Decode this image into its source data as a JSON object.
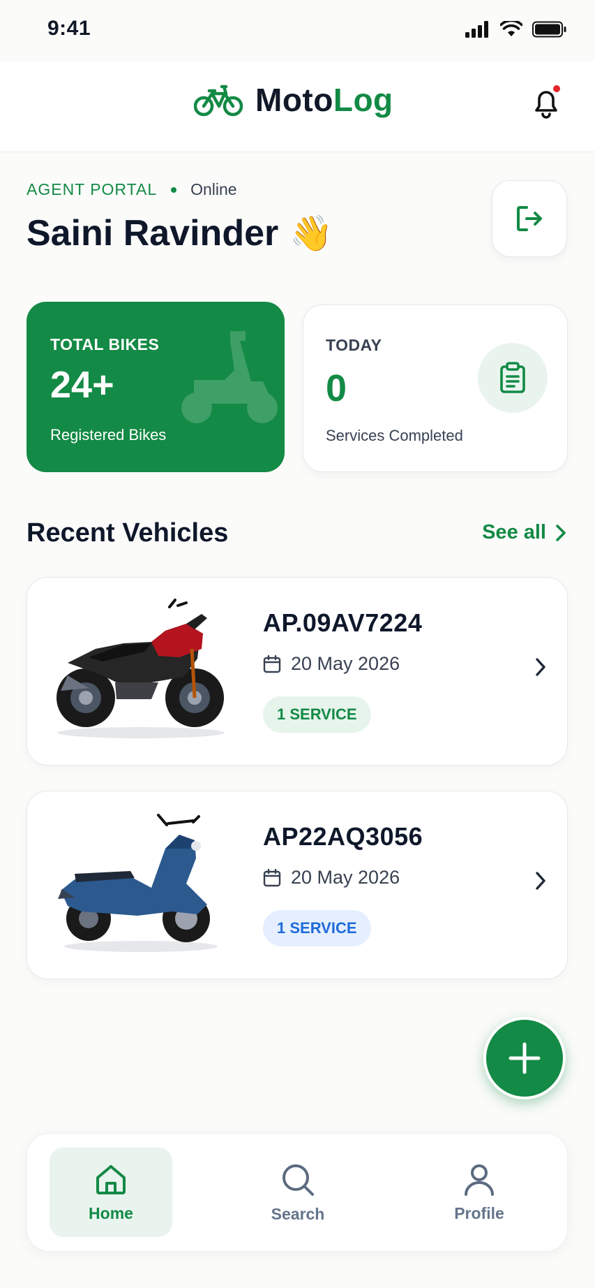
{
  "status_bar": {
    "time": "9:41"
  },
  "header": {
    "brand_part1": "Moto",
    "brand_part2": "Log",
    "notification_icon": "bell-icon",
    "has_unread": true
  },
  "greeting": {
    "portal_label": "AGENT PORTAL",
    "status": "Online",
    "name": "Saini Ravinder",
    "emoji": "👋"
  },
  "stats": {
    "total": {
      "label": "TOTAL BIKES",
      "value": "24+",
      "subtitle": "Registered Bikes"
    },
    "today": {
      "label": "TODAY",
      "value": "0",
      "subtitle": "Services Completed"
    }
  },
  "recent": {
    "title": "Recent Vehicles",
    "see_all": "See all",
    "vehicles": [
      {
        "plate": "AP.09AV7224",
        "date": "20 May 2026",
        "badge": "1 SERVICE",
        "badge_color": "#138a45",
        "type": "motorcycle"
      },
      {
        "plate": "AP22AQ3056",
        "date": "20 May 2026",
        "badge": "1 SERVICE",
        "badge_color": "#1f6bd8",
        "type": "scooter"
      }
    ]
  },
  "nav": {
    "items": [
      {
        "label": "Home",
        "active": true
      },
      {
        "label": "Search",
        "active": false
      },
      {
        "label": "Profile",
        "active": false
      }
    ]
  },
  "colors": {
    "brand": "#138a45",
    "accent_blue": "#1f6bd8",
    "alert": "#e5252a"
  }
}
